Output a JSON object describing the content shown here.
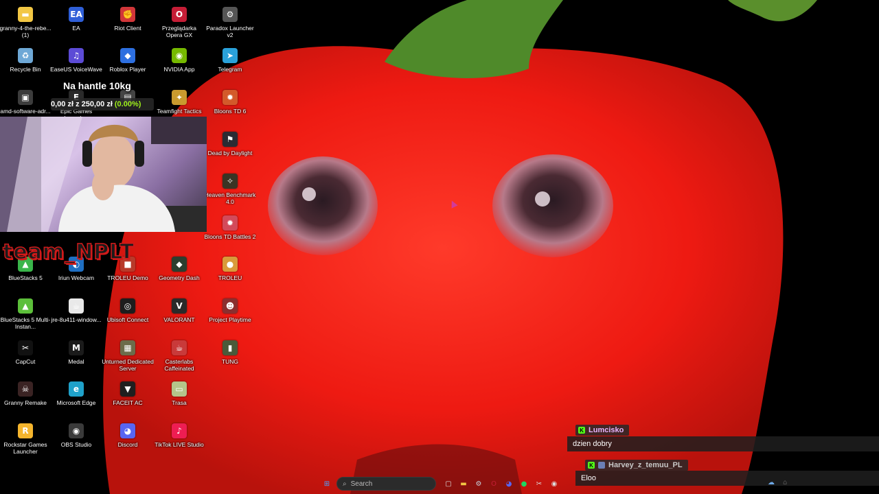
{
  "desktop_icons": [
    {
      "label": "granny-4-the-rebe... (1)",
      "icon": "folder-icon",
      "color": "#f2c744",
      "glyph": "▬"
    },
    {
      "label": "EA",
      "icon": "ea-icon",
      "color": "#2f5fd8",
      "glyph": "EA"
    },
    {
      "label": "Riot Client",
      "icon": "riot-icon",
      "color": "#d13639",
      "glyph": "✊"
    },
    {
      "label": "Przeglądarka Opera GX",
      "icon": "opera-gx-icon",
      "color": "#c51d36",
      "glyph": "O"
    },
    {
      "label": "Paradox Launcher v2",
      "icon": "paradox-icon",
      "color": "#555555",
      "glyph": "⚙"
    },
    {
      "label": "Recycle Bin",
      "icon": "recycle-bin-icon",
      "color": "#6ea8d6",
      "glyph": "♻"
    },
    {
      "label": "EaseUS VoiceWave",
      "icon": "voicewave-icon",
      "color": "#5c4bd6",
      "glyph": "♫"
    },
    {
      "label": "Roblox Player",
      "icon": "roblox-icon",
      "color": "#2d6fe0",
      "glyph": "◆"
    },
    {
      "label": "NVIDIA App",
      "icon": "nvidia-icon",
      "color": "#76b900",
      "glyph": "◉"
    },
    {
      "label": "Telegram",
      "icon": "telegram-icon",
      "color": "#2aa1da",
      "glyph": "➤"
    },
    {
      "label": "amd-software-adr...",
      "icon": "amd-icon",
      "color": "#3c3c3c",
      "glyph": "▣"
    },
    {
      "label": "Epic Games Launcher",
      "icon": "epic-icon",
      "color": "#2a2a2a",
      "glyph": "E"
    },
    {
      "label": "",
      "icon": "app-icon",
      "color": "#444444",
      "glyph": "▤"
    },
    {
      "label": "Teamfight Tactics",
      "icon": "tft-icon",
      "color": "#c99a2e",
      "glyph": "✦"
    },
    {
      "label": "Bloons TD 6",
      "icon": "bloons-td6-icon",
      "color": "#d35a2a",
      "glyph": "✹"
    },
    {
      "label": "Dead by Daylight",
      "icon": "dbd-icon",
      "color": "#2b2b33",
      "glyph": "⚑"
    },
    {
      "label": "Heaven Benchmark 4.0",
      "icon": "heaven-icon",
      "color": "#3a3424",
      "glyph": "✧"
    },
    {
      "label": "Bloons TD Battles 2",
      "icon": "bloons-battles-icon",
      "color": "#d34a5a",
      "glyph": "✹"
    },
    {
      "label": "BlueStacks 5",
      "icon": "bluestacks-icon",
      "color": "#3ab54a",
      "glyph": "▲"
    },
    {
      "label": "Iriun Webcam",
      "icon": "iriun-icon",
      "color": "#1f6fc2",
      "glyph": "◐"
    },
    {
      "label": "TROLEU Demo",
      "icon": "troleu-demo-icon",
      "color": "#b83a2a",
      "glyph": "■"
    },
    {
      "label": "Geometry Dash",
      "icon": "geometry-dash-icon",
      "color": "#2c3e2f",
      "glyph": "◆"
    },
    {
      "label": "TROLEU",
      "icon": "troleu-icon",
      "color": "#d99a3a",
      "glyph": "●"
    },
    {
      "label": "BlueStacks 5 Multi-Instan...",
      "icon": "bluestacks-multi-icon",
      "color": "#5cbf3a",
      "glyph": "▲"
    },
    {
      "label": "jre-8u411-window...",
      "icon": "java-icon",
      "color": "#e9e9e9",
      "glyph": "☕"
    },
    {
      "label": "Ubisoft Connect",
      "icon": "ubisoft-icon",
      "color": "#1d1d1d",
      "glyph": "◎"
    },
    {
      "label": "VALORANT",
      "icon": "valorant-icon",
      "color": "#2a2a2a",
      "glyph": "V"
    },
    {
      "label": "Project Playtime",
      "icon": "project-playtime-icon",
      "color": "#8a2f2f",
      "glyph": "☻"
    },
    {
      "label": "CapCut",
      "icon": "capcut-icon",
      "color": "#111111",
      "glyph": "✂"
    },
    {
      "label": "Medal",
      "icon": "medal-icon",
      "color": "#1b1b1b",
      "glyph": "M"
    },
    {
      "label": "Unturned Dedicated Server",
      "icon": "unturned-icon",
      "color": "#6c6c4a",
      "glyph": "▦"
    },
    {
      "label": "Casterlabs Caffeinated",
      "icon": "casterlabs-icon",
      "color": "#c93a3a",
      "glyph": "☕"
    },
    {
      "label": "TUNG",
      "icon": "tung-icon",
      "color": "#4a5a3a",
      "glyph": "▮"
    },
    {
      "label": "Granny Remake",
      "icon": "granny-remake-icon",
      "color": "#3a2323",
      "glyph": "☠"
    },
    {
      "label": "Microsoft Edge",
      "icon": "edge-icon",
      "color": "#1fa1c9",
      "glyph": "e"
    },
    {
      "label": "FACEIT AC",
      "icon": "faceit-icon",
      "color": "#1f1f1f",
      "glyph": "▼"
    },
    {
      "label": "Trasa",
      "icon": "trasa-icon",
      "color": "#b5c48a",
      "glyph": "▭"
    },
    {
      "label": "Rockstar Games Launcher",
      "icon": "rockstar-icon",
      "color": "#f5b52d",
      "glyph": "R"
    },
    {
      "label": "OBS Studio",
      "icon": "obs-icon",
      "color": "#3a3a3a",
      "glyph": "◉"
    },
    {
      "label": "Discord",
      "icon": "discord-icon",
      "color": "#5865f2",
      "glyph": "◕"
    },
    {
      "label": "TikTok LIVE Studio",
      "icon": "tiktok-live-icon",
      "color": "#ee1d52",
      "glyph": "♪"
    }
  ],
  "overlay": {
    "goal_title": "Na hantle 10kg",
    "goal_amount": "0,00 zł z 250,00 zł",
    "goal_percent": "(0.00%)",
    "goal_fraction": 0.0,
    "team_tag": "team_NPLT"
  },
  "chat": [
    {
      "user": "Lumcisko",
      "user_color": "#e7b3ff",
      "message": "dzien dobry"
    },
    {
      "user": "Harvey_z_temuu_PL",
      "user_color": "#c8c8c8",
      "message": "Eloo"
    }
  ],
  "taskbar": {
    "search_placeholder": "Search",
    "pinned": [
      {
        "icon": "task-view-icon",
        "glyph": "▢",
        "color": "#dddddd"
      },
      {
        "icon": "file-explorer-icon",
        "glyph": "▬",
        "color": "#f2c744"
      },
      {
        "icon": "steam-icon",
        "glyph": "⚙",
        "color": "#c7d5e0"
      },
      {
        "icon": "opera-gx-taskbar-icon",
        "glyph": "O",
        "color": "#c51d36"
      },
      {
        "icon": "discord-taskbar-icon",
        "glyph": "◕",
        "color": "#5865f2"
      },
      {
        "icon": "spotify-icon",
        "glyph": "●",
        "color": "#1ed760"
      },
      {
        "icon": "capcut-taskbar-icon",
        "glyph": "✂",
        "color": "#dddddd"
      },
      {
        "icon": "obs-taskbar-icon",
        "glyph": "◉",
        "color": "#dddddd"
      }
    ]
  }
}
